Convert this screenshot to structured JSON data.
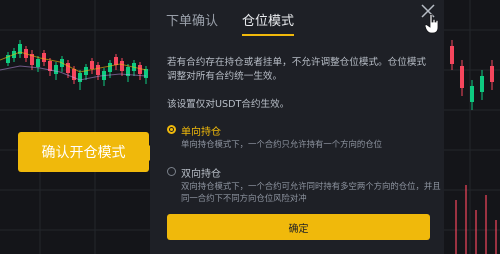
{
  "dialog": {
    "tabs": [
      {
        "label": "下单确认",
        "active": false
      },
      {
        "label": "仓位模式",
        "active": true
      }
    ],
    "description": "若有合约存在持仓或者挂单，不允许调整仓位模式。仓位模式调整对所有合约统一生效。",
    "note": "该设置仅对USDT合约生效。",
    "options": [
      {
        "title": "单向持仓",
        "description": "单向持仓模式下，一个合约只允许持有一个方向的仓位",
        "selected": true
      },
      {
        "title": "双向持仓",
        "description": "双向持仓模式下，一个合约可允许同时持有多空两个方向的仓位，并且同一合约下不同方向仓位风险对冲",
        "selected": false
      }
    ],
    "confirm_label": "确定",
    "close_icon": "close-icon"
  },
  "callout": {
    "label": "确认开仓模式"
  },
  "colors": {
    "accent": "#F0B90B",
    "dialog_bg": "#1E2026",
    "page_bg": "#141519",
    "up": "#0ECB81",
    "down": "#F6465D"
  }
}
